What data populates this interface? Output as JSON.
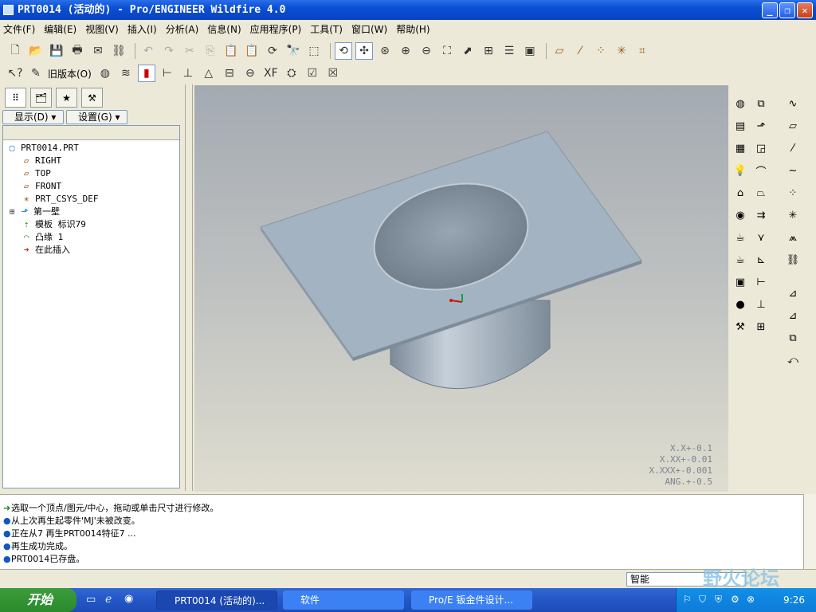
{
  "window": {
    "title": "PRT0014 (活动的) - Pro/ENGINEER Wildfire 4.0",
    "min": "_",
    "max": "❐",
    "close": "✕"
  },
  "menu": [
    "文件(F)",
    "编辑(E)",
    "视图(V)",
    "插入(I)",
    "分析(A)",
    "信息(N)",
    "应用程序(P)",
    "工具(T)",
    "窗口(W)",
    "帮助(H)"
  ],
  "toolbar2": {
    "legacy_label": "旧版本(O)"
  },
  "navigator": {
    "show_button": "显示(D) ▾",
    "settings_button": "设置(G) ▾",
    "tree": [
      {
        "label": "PRT0014.PRT",
        "icon": "part-icon"
      },
      {
        "label": "RIGHT",
        "icon": "datum-plane-icon"
      },
      {
        "label": "TOP",
        "icon": "datum-plane-icon"
      },
      {
        "label": "FRONT",
        "icon": "datum-plane-icon"
      },
      {
        "label": "PRT_CSYS_DEF",
        "icon": "csys-icon"
      },
      {
        "label": "第一壁",
        "icon": "wall-icon"
      },
      {
        "label": "模板 标识79",
        "icon": "form-icon"
      },
      {
        "label": "凸缘 1",
        "icon": "flange-icon"
      },
      {
        "label": "在此插入",
        "icon": "insert-arrow-icon"
      }
    ]
  },
  "graphics": {
    "tolerances": [
      "X.X+-0.1",
      "X.XX+-0.01",
      "X.XXX+-0.001",
      "ANG.+-0.5"
    ],
    "model_color": "#a3b3c1"
  },
  "messages": [
    "选取一个顶点/图元/中心，拖动或单击尺寸进行修改。",
    "从上次再生起零件'MJ'未被改变。",
    "正在从7 再生PRT0014特征7 ...",
    "再生成功完成。",
    "PRT0014已存盘。"
  ],
  "status": {
    "filter": "智能"
  },
  "taskbar": {
    "start": "开始",
    "tasks": [
      "PRT0014 (活动的)...",
      "软件",
      "Pro/E 钣金件设计..."
    ],
    "clock": "9:26"
  },
  "watermark": "野火论坛"
}
